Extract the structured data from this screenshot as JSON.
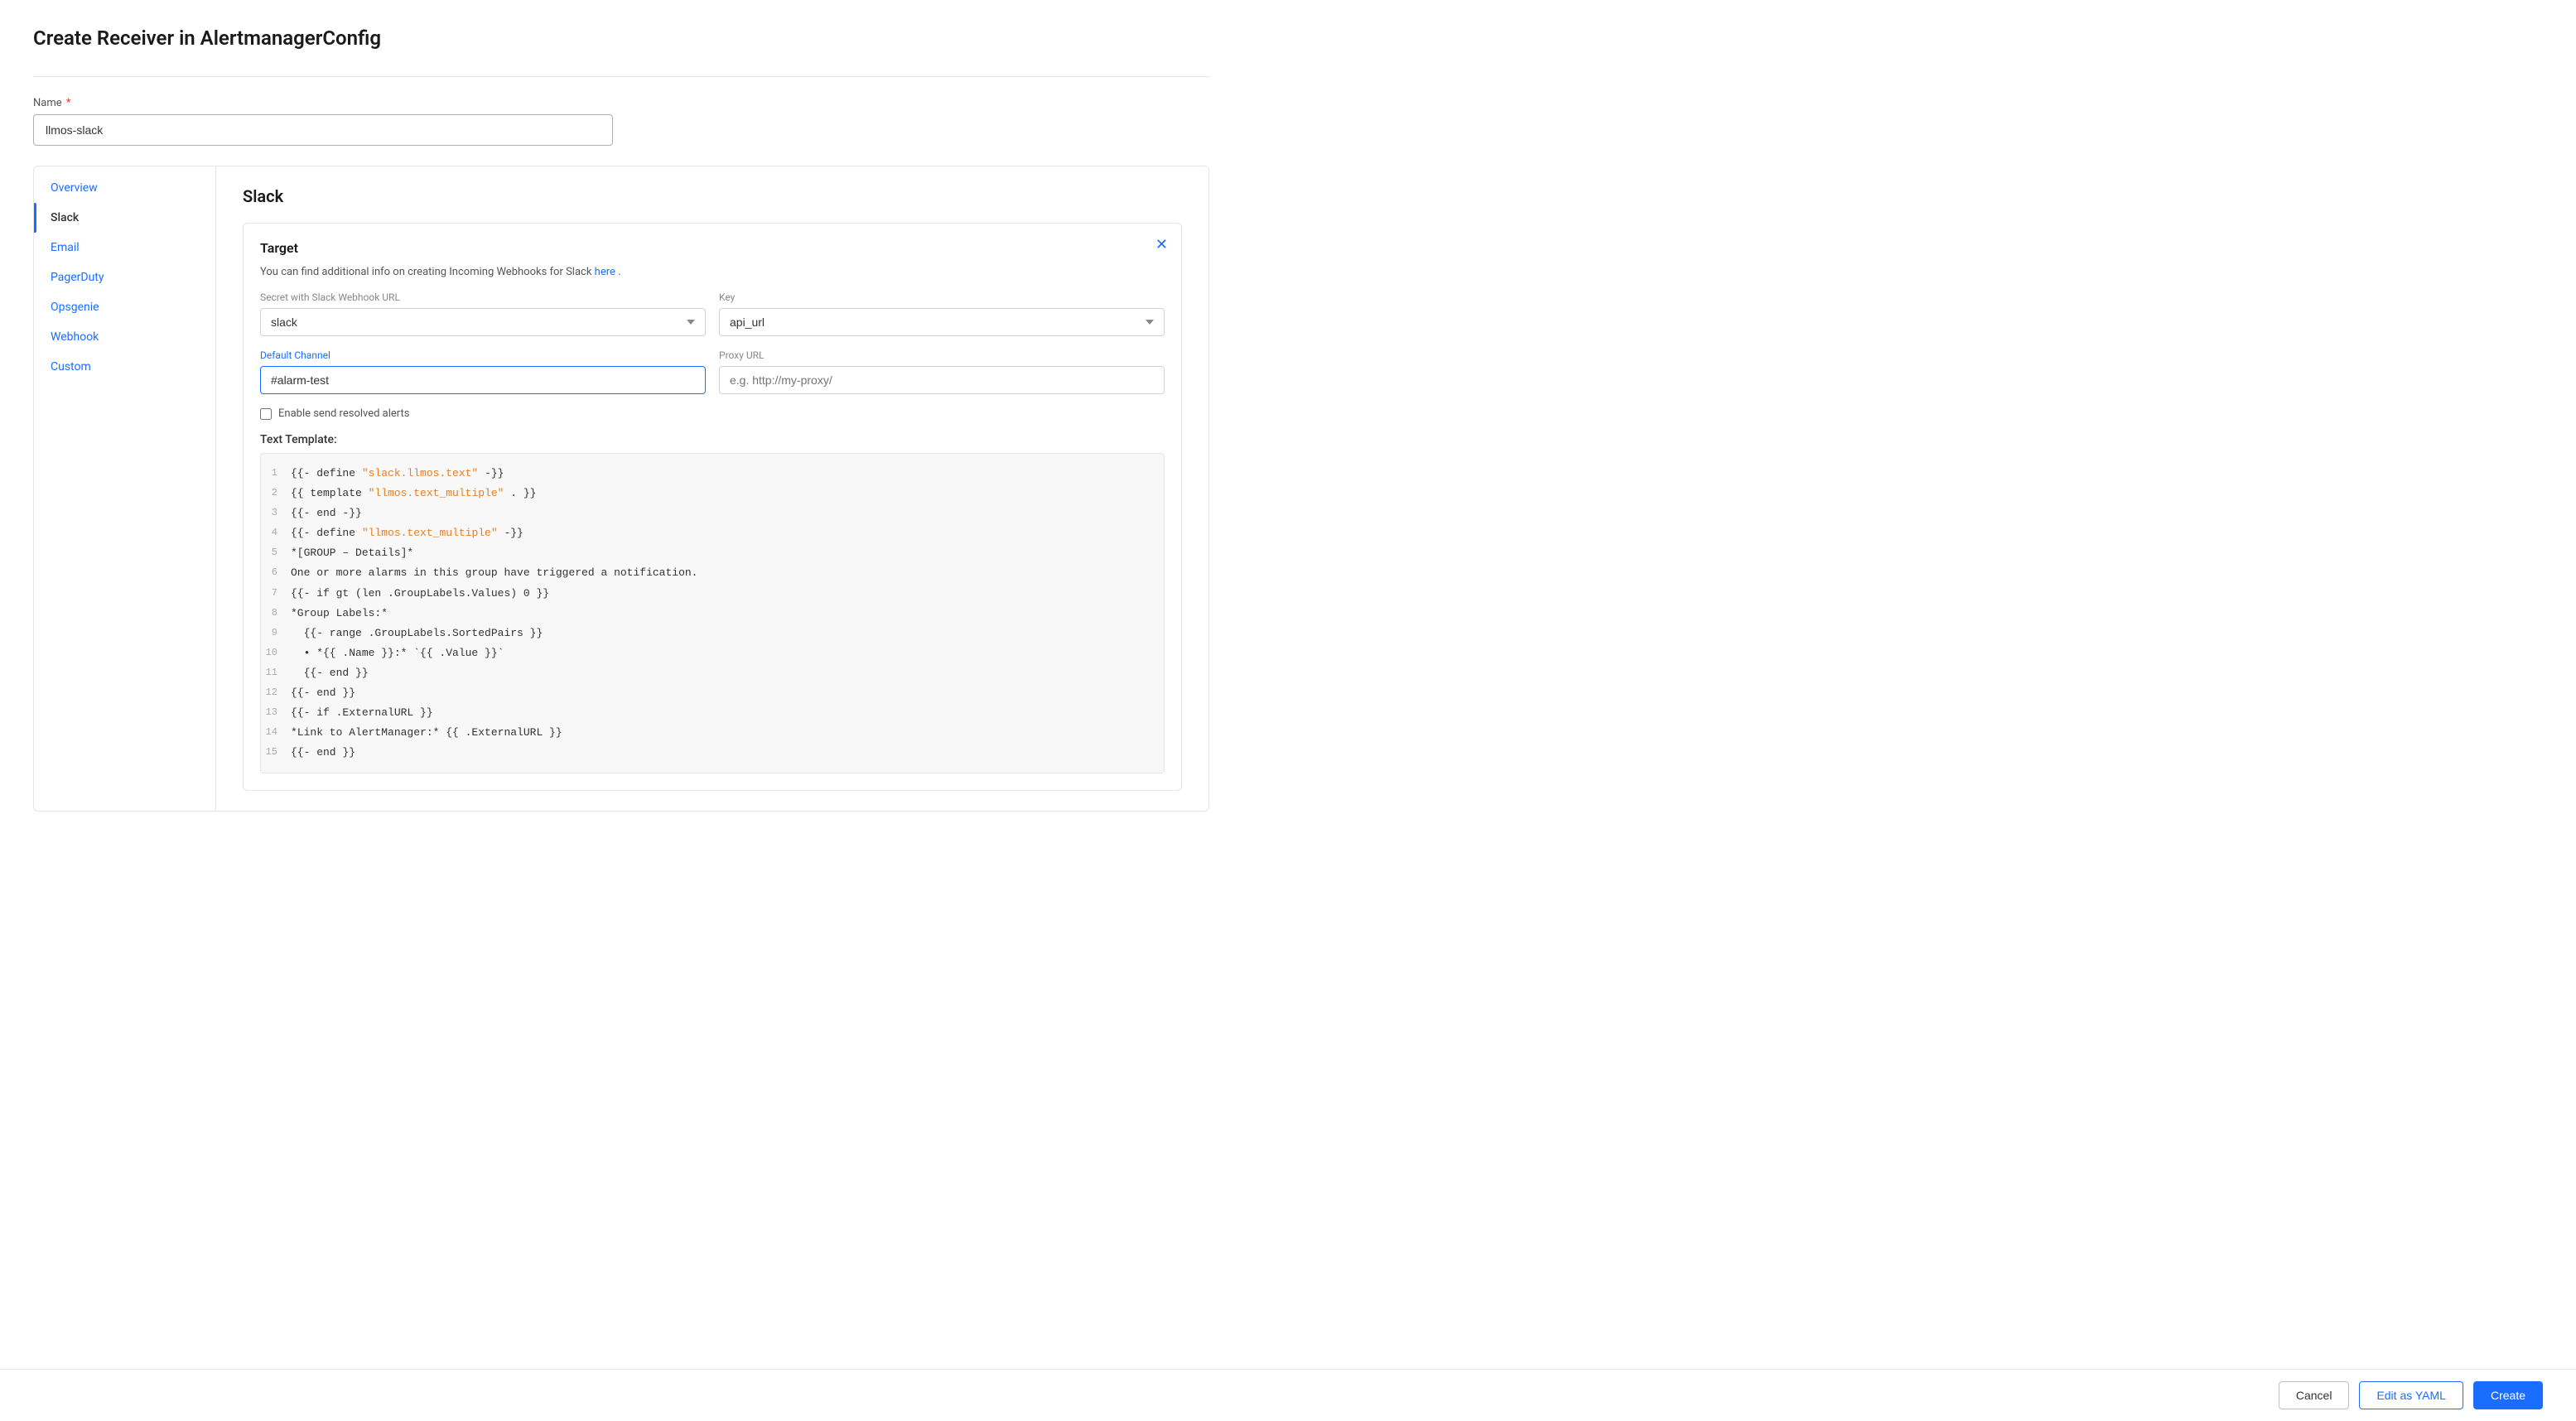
{
  "page": {
    "title": "Create Receiver in AlertmanagerConfig"
  },
  "name_field": {
    "label": "Name",
    "required": true,
    "value": "llmos-slack",
    "placeholder": ""
  },
  "sidebar": {
    "items": [
      {
        "id": "overview",
        "label": "Overview",
        "active": false
      },
      {
        "id": "slack",
        "label": "Slack",
        "active": true
      },
      {
        "id": "email",
        "label": "Email",
        "active": false
      },
      {
        "id": "pagerduty",
        "label": "PagerDuty",
        "active": false
      },
      {
        "id": "opsgenie",
        "label": "Opsgenie",
        "active": false
      },
      {
        "id": "webhook",
        "label": "Webhook",
        "active": false
      },
      {
        "id": "custom",
        "label": "Custom",
        "active": false
      }
    ]
  },
  "content": {
    "section_title": "Slack",
    "target": {
      "title": "Target",
      "info_text": "You can find additional info on creating Incoming Webhooks for Slack",
      "info_link_text": "here",
      "info_suffix": ".",
      "secret_label": "Secret with Slack Webhook URL",
      "secret_value": "slack",
      "key_label": "Key",
      "key_value": "api_url",
      "channel_label": "Default Channel",
      "channel_value": "#alarm-test",
      "proxy_label": "Proxy URL",
      "proxy_placeholder": "e.g. http://my-proxy/",
      "enable_resolved_label": "Enable send resolved alerts"
    },
    "template": {
      "label": "Text Template:",
      "lines": [
        {
          "num": 1,
          "content": "{{- define ",
          "orange": "\"slack.llmos.text\"",
          "rest": " -}}"
        },
        {
          "num": 2,
          "content": "{{ template ",
          "orange": "\"llmos.text_multiple\"",
          "rest": " . }}"
        },
        {
          "num": 3,
          "content": "{{- end -}}",
          "orange": "",
          "rest": ""
        },
        {
          "num": 4,
          "content": "{{- define ",
          "orange": "\"llmos.text_multiple\"",
          "rest": " -}}"
        },
        {
          "num": 5,
          "content": "*[GROUP – Details]*",
          "orange": "",
          "rest": ""
        },
        {
          "num": 6,
          "content": "One or more alarms in this group have triggered a notification.",
          "orange": "",
          "rest": ""
        },
        {
          "num": 7,
          "content": "{{- if gt (len .GroupLabels.Values) 0 }}",
          "orange": "",
          "rest": ""
        },
        {
          "num": 8,
          "content": "*Group Labels:*",
          "orange": "",
          "rest": ""
        },
        {
          "num": 9,
          "content": "  {{- range .GroupLabels.SortedPairs }}",
          "orange": "",
          "rest": ""
        },
        {
          "num": 10,
          "content": "  • *{{ .Name }}:* `{{ .Value }}`",
          "orange": "",
          "rest": ""
        },
        {
          "num": 11,
          "content": "  {{- end }}",
          "orange": "",
          "rest": ""
        },
        {
          "num": 12,
          "content": "{{- end }}",
          "orange": "",
          "rest": ""
        },
        {
          "num": 13,
          "content": "{{- if .ExternalURL }}",
          "orange": "",
          "rest": ""
        },
        {
          "num": 14,
          "content": "*Link to AlertManager:* {{ .ExternalURL }}",
          "orange": "",
          "rest": ""
        },
        {
          "num": 15,
          "content": "{{- end }}",
          "orange": "",
          "rest": ""
        }
      ]
    }
  },
  "footer": {
    "cancel_label": "Cancel",
    "yaml_label": "Edit as YAML",
    "create_label": "Create"
  }
}
